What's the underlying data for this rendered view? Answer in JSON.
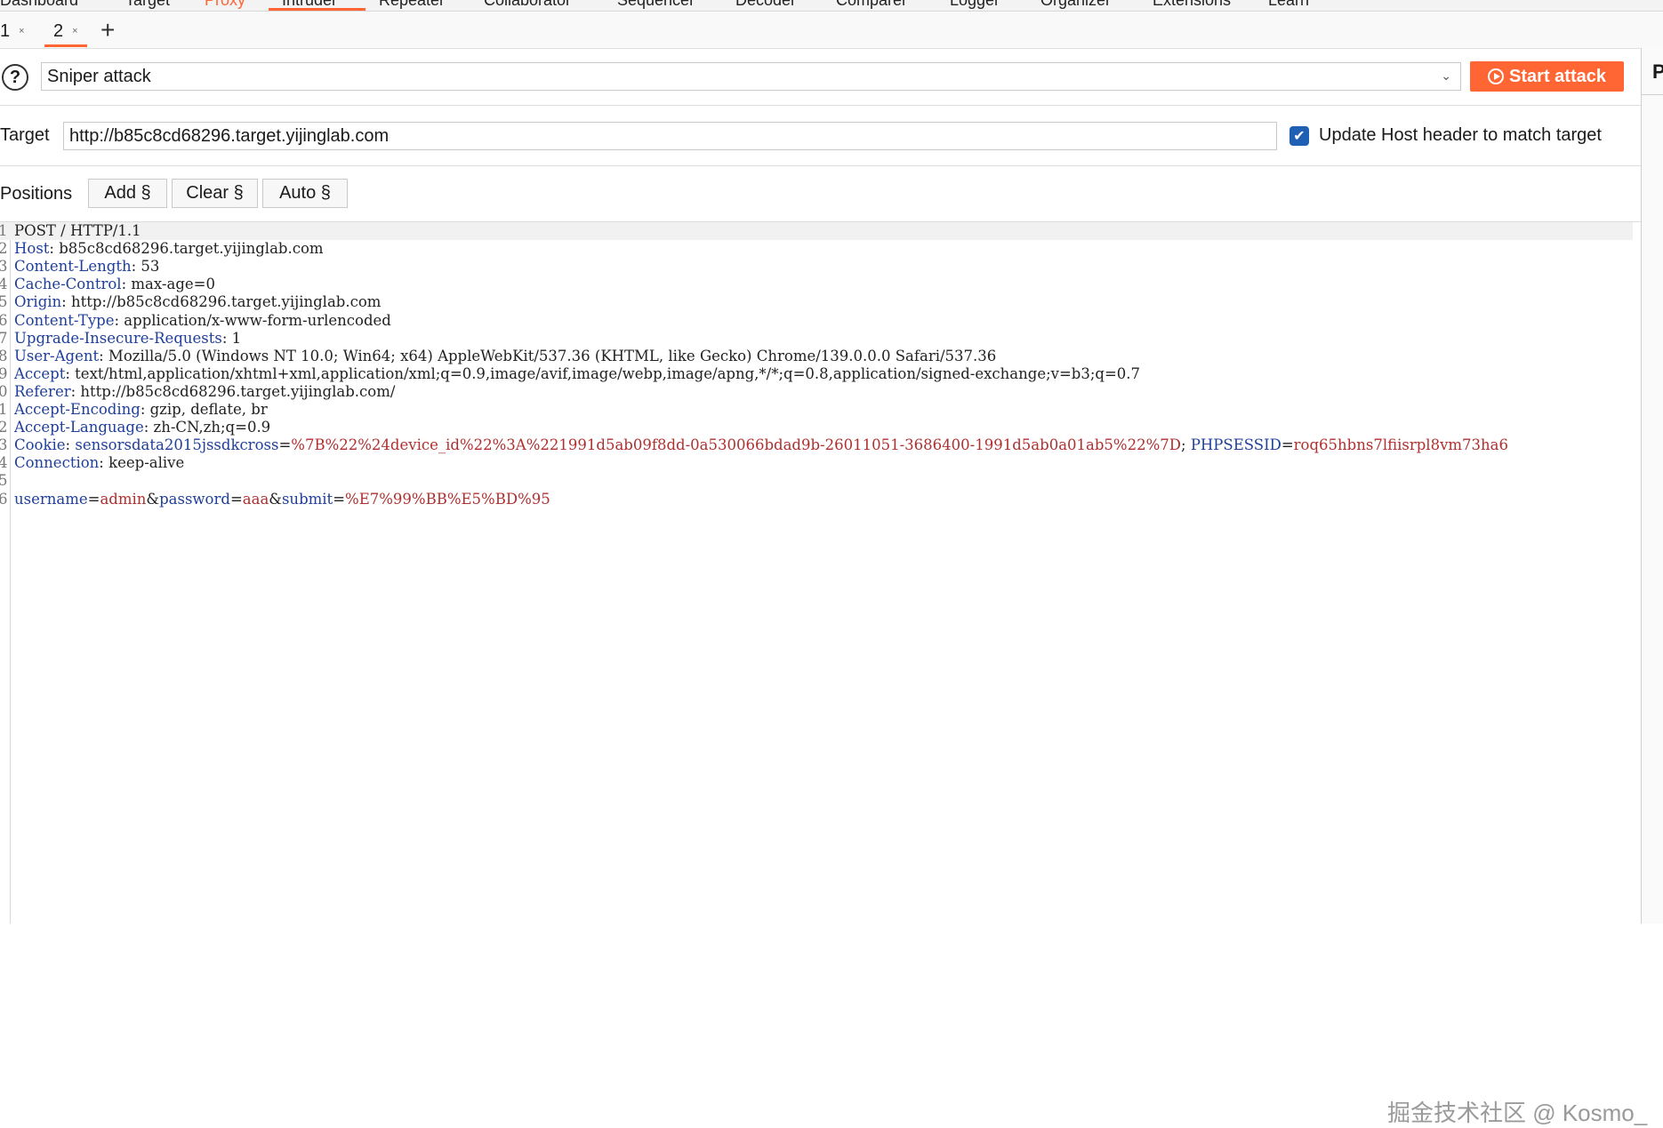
{
  "tool_tabs": [
    "Dashboard",
    "Target",
    "Proxy",
    "Intruder",
    "Repeater",
    "Collaborator",
    "Sequencer",
    "Decoder",
    "Comparer",
    "Logger",
    "Organizer",
    "Extensions",
    "Learn"
  ],
  "sub_tabs": [
    {
      "label": "1",
      "close": "×"
    },
    {
      "label": "2",
      "close": "×"
    }
  ],
  "add_tab": "+",
  "right_panel_letter": "P",
  "help_icon": "?",
  "attack_type": "Sniper attack",
  "attack_chevron": "⌄",
  "start_attack_label": "Start attack",
  "target": {
    "label": "Target",
    "value": "http://b85c8cd68296.target.yijinglab.com"
  },
  "update_host": {
    "checked": true,
    "label": "Update Host header to match target"
  },
  "positions": {
    "label": "Positions",
    "add": "Add §",
    "clear": "Clear §",
    "auto": "Auto §"
  },
  "request_lines": [
    {
      "n": "1",
      "key": "",
      "sep": "",
      "val": "POST / HTTP/1.1"
    },
    {
      "n": "2",
      "key": "Host",
      "sep": ": ",
      "val": "b85c8cd68296.target.yijinglab.com"
    },
    {
      "n": "3",
      "key": "Content-Length",
      "sep": ": ",
      "val": "53"
    },
    {
      "n": "4",
      "key": "Cache-Control",
      "sep": ": ",
      "val": "max-age=0"
    },
    {
      "n": "5",
      "key": "Origin",
      "sep": ": ",
      "val": "http://b85c8cd68296.target.yijinglab.com"
    },
    {
      "n": "6",
      "key": "Content-Type",
      "sep": ": ",
      "val": "application/x-www-form-urlencoded"
    },
    {
      "n": "7",
      "key": "Upgrade-Insecure-Requests",
      "sep": ": ",
      "val": "1"
    },
    {
      "n": "8",
      "key": "User-Agent",
      "sep": ": ",
      "val": "Mozilla/5.0 (Windows NT 10.0; Win64; x64) AppleWebKit/537.36 (KHTML, like Gecko) Chrome/139.0.0.0 Safari/537.36"
    },
    {
      "n": "9",
      "key": "Accept",
      "sep": ": ",
      "val": "text/html,application/xhtml+xml,application/xml;q=0.9,image/avif,image/webp,image/apng,*/*;q=0.8,application/signed-exchange;v=b3;q=0.7"
    },
    {
      "n": "0",
      "key": "Referer",
      "sep": ": ",
      "val": "http://b85c8cd68296.target.yijinglab.com/"
    },
    {
      "n": "1",
      "key": "Accept-Encoding",
      "sep": ": ",
      "val": "gzip, deflate, br"
    },
    {
      "n": "2",
      "key": "Accept-Language",
      "sep": ": ",
      "val": "zh-CN,zh;q=0.9"
    },
    {
      "n": "3",
      "key": "Cookie",
      "sep": ": ",
      "cookie": {
        "k1": "sensorsdata2015jssdkcross",
        "v1": "%7B%22%24device_id%22%3A%221991d5ab09f8dd-0a530066bdad9b-26011051-3686400-1991d5ab0a01ab5%22%7D",
        "k2": "PHPSESSID",
        "v2": "roq65hbns7lfiisrpl8vm73ha6"
      }
    },
    {
      "n": "4",
      "key": "Connection",
      "sep": ": ",
      "val": "keep-alive"
    },
    {
      "n": "5",
      "key": "",
      "sep": "",
      "val": ""
    },
    {
      "n": "6",
      "body": {
        "k1": "username",
        "v1": "admin",
        "k2": "password",
        "v2": "aaa",
        "k3": "submit",
        "v3": "%E7%99%BB%E5%BD%95"
      }
    }
  ],
  "watermark": "掘金技术社区 @ Kosmo_"
}
